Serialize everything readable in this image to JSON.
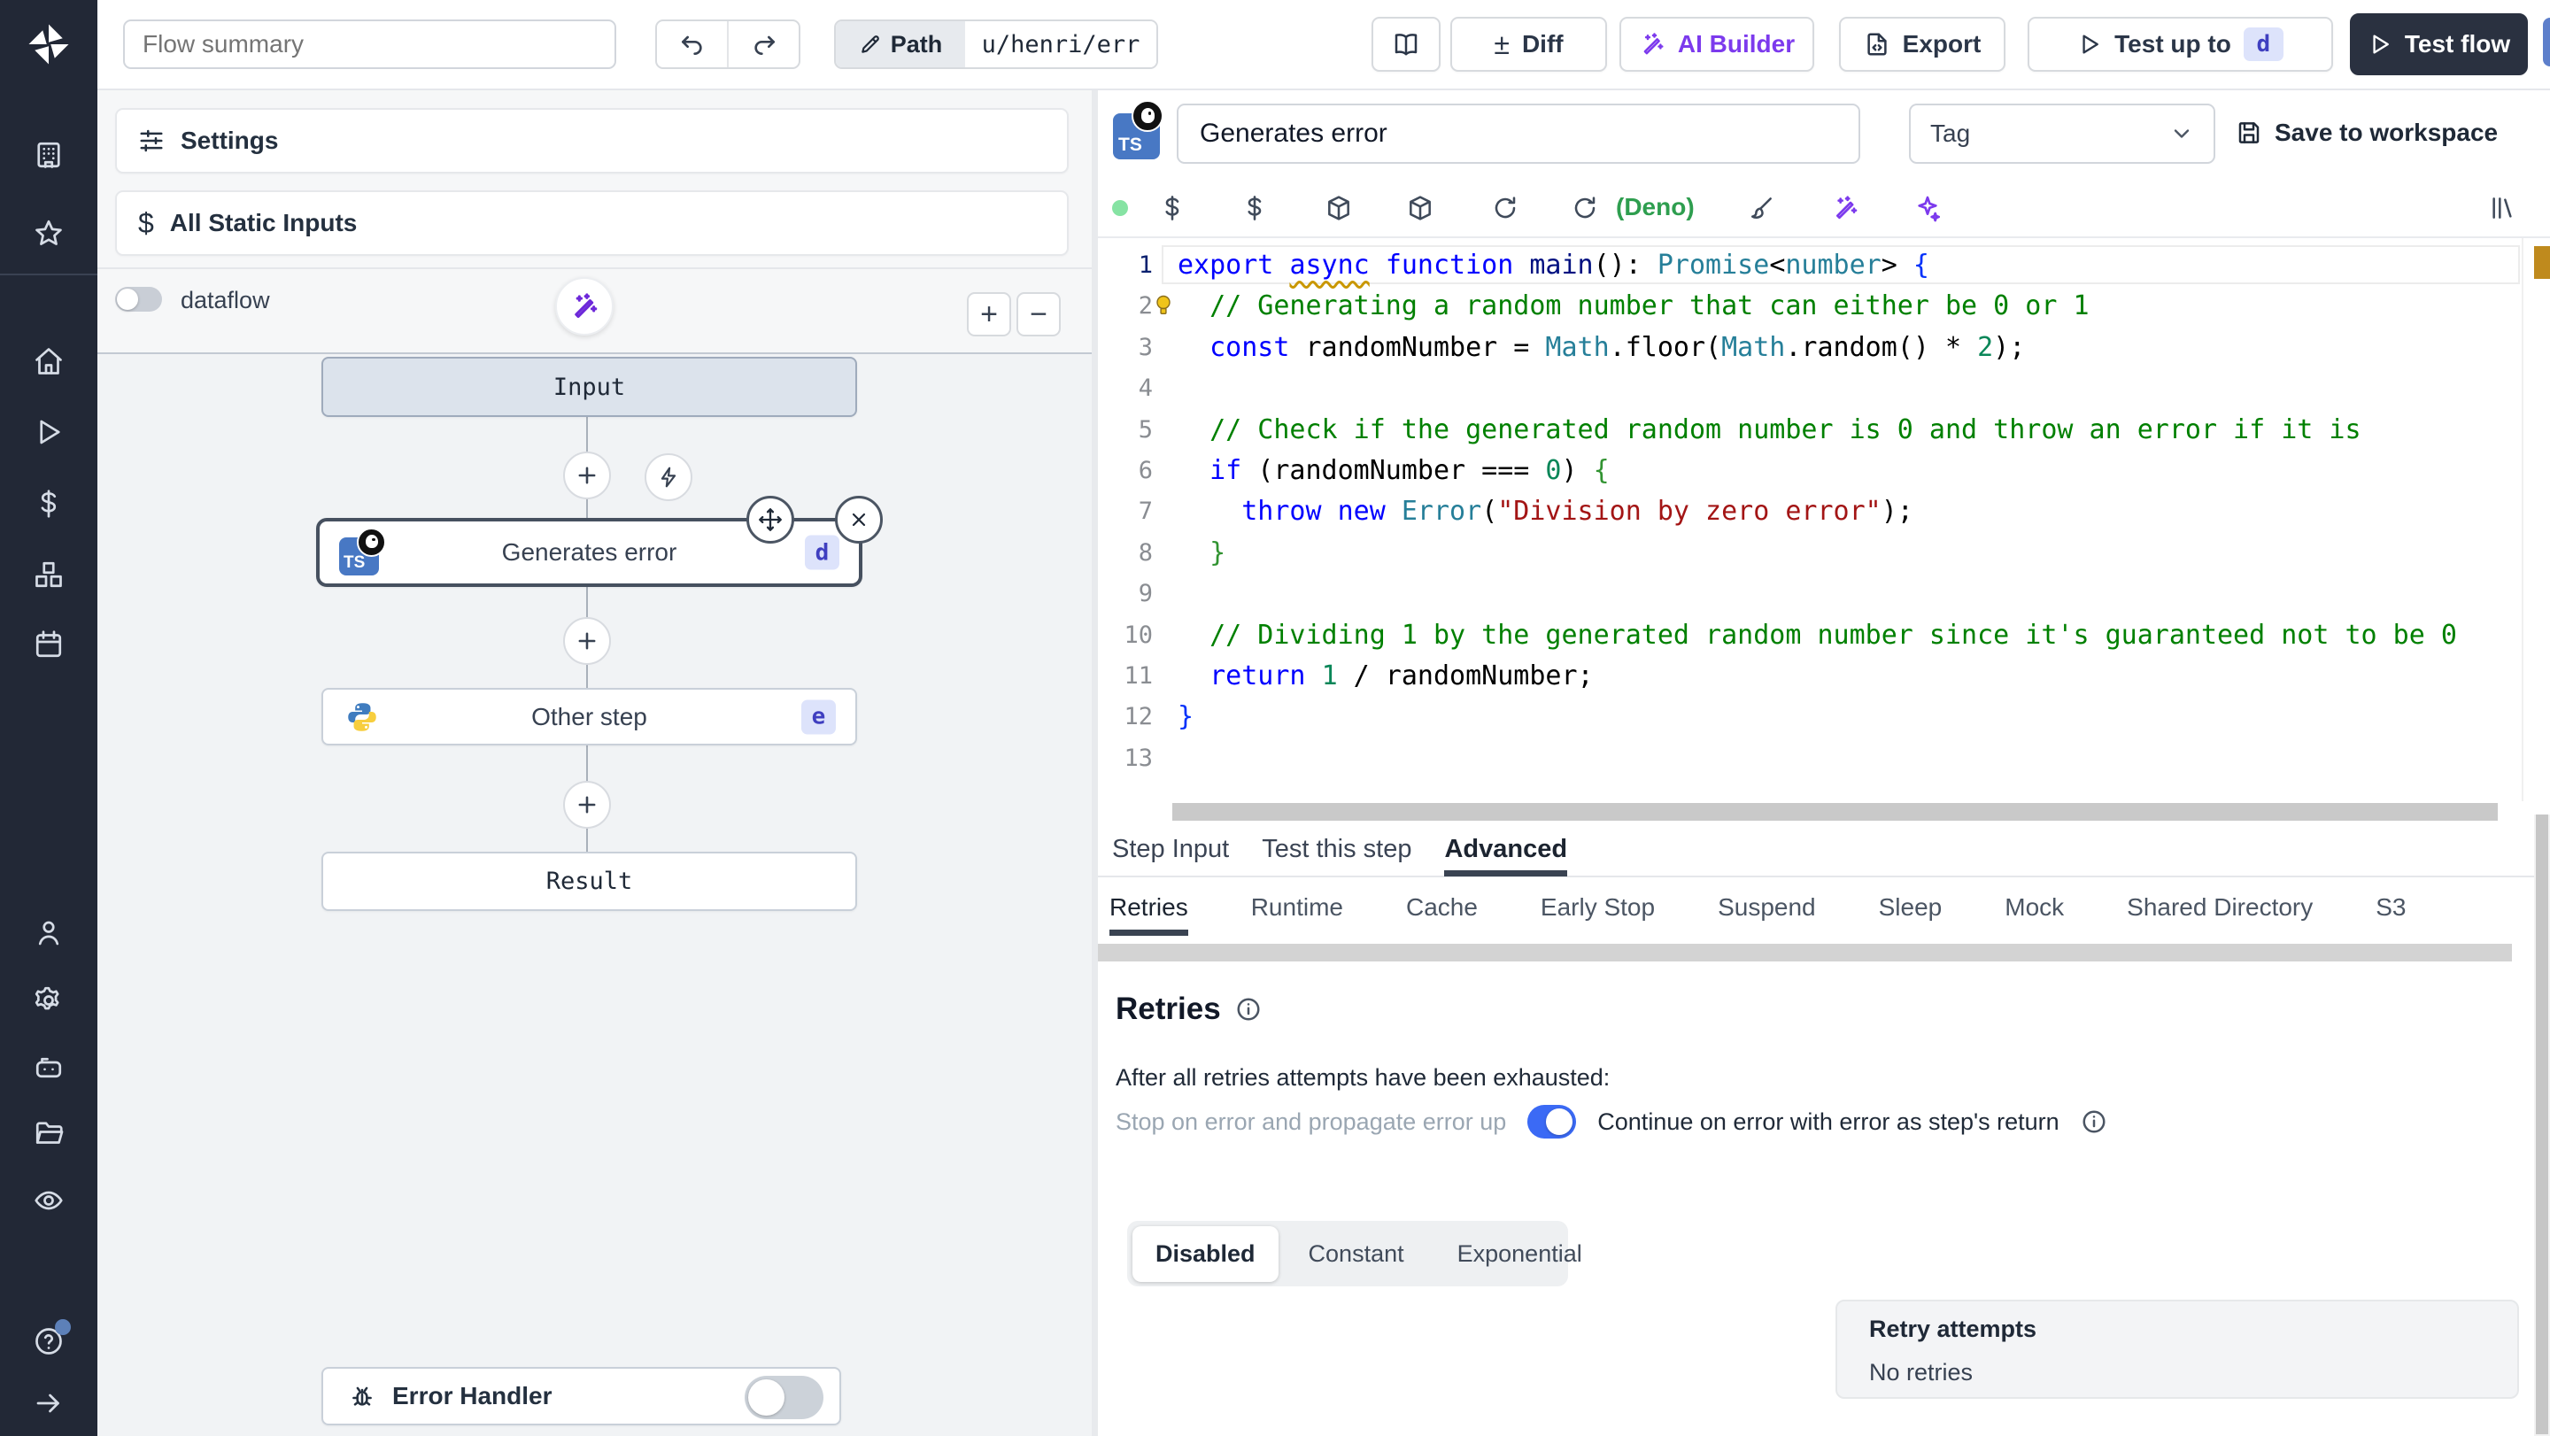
{
  "topbar": {
    "flow_summary_placeholder": "Flow summary",
    "path_label": "Path",
    "path_value": "u/henri/err",
    "diff_symbol": "±",
    "diff_label": "Diff",
    "ai_builder_label": "AI Builder",
    "export_label": "Export",
    "test_up_to_label": "Test up to",
    "test_up_to_badge": "d",
    "test_flow_label": "Test flow"
  },
  "flow_panel": {
    "settings_label": "Settings",
    "static_inputs_symbol": "$",
    "static_inputs_label": "All Static Inputs",
    "dataflow_label": "dataflow",
    "zoom_in_label": "+",
    "zoom_out_label": "−",
    "nodes": {
      "input_label": "Input",
      "step1_label": "Generates error",
      "step1_badge": "d",
      "step2_label": "Other step",
      "step2_badge": "e",
      "result_label": "Result"
    },
    "error_handler_label": "Error Handler"
  },
  "editor": {
    "step_name": "Generates error",
    "tag_placeholder": "Tag",
    "save_label": "Save to workspace",
    "runtime_label": "(Deno)",
    "tabs": [
      "Step Input",
      "Test this step",
      "Advanced"
    ],
    "active_tab": "Advanced",
    "subtabs": [
      "Retries",
      "Runtime",
      "Cache",
      "Early Stop",
      "Suspend",
      "Sleep",
      "Mock",
      "Shared Directory",
      "S3"
    ],
    "active_subtab": "Retries",
    "code": {
      "language": "typescript",
      "bulb_line": 2,
      "current_line": 1,
      "lines": [
        [
          [
            "kw",
            "export "
          ],
          [
            "kww",
            "async"
          ],
          [
            "pl",
            " "
          ],
          [
            "kw",
            "function "
          ],
          [
            "fn",
            "main"
          ],
          [
            "pl",
            "(): "
          ],
          [
            "ty",
            "Promise"
          ],
          [
            "pl",
            "<"
          ],
          [
            "ty",
            "number"
          ],
          [
            "pl",
            "> "
          ],
          [
            "b1",
            "{"
          ]
        ],
        [
          [
            "cm",
            "  // Generating a random number that can either be 0 or 1"
          ]
        ],
        [
          [
            "kw",
            "  const"
          ],
          [
            "pl",
            " randomNumber = "
          ],
          [
            "ty",
            "Math"
          ],
          [
            "pl",
            ".floor("
          ],
          [
            "ty",
            "Math"
          ],
          [
            "pl",
            ".random() * "
          ],
          [
            "nu",
            "2"
          ],
          [
            "pl",
            ");"
          ]
        ],
        [],
        [
          [
            "cm",
            "  // Check if the generated random number is 0 and throw an error if it is"
          ]
        ],
        [
          [
            "kw",
            "  if"
          ],
          [
            "pl",
            " (randomNumber === "
          ],
          [
            "nu",
            "0"
          ],
          [
            "pl",
            ") "
          ],
          [
            "b2",
            "{"
          ]
        ],
        [
          [
            "kw",
            "    throw"
          ],
          [
            "pl",
            " "
          ],
          [
            "kw",
            "new"
          ],
          [
            "pl",
            " "
          ],
          [
            "ty",
            "Error"
          ],
          [
            "pl",
            "("
          ],
          [
            "st",
            "\"Division by zero error\""
          ],
          [
            "pl",
            ");"
          ]
        ],
        [
          [
            "b2",
            "  }"
          ]
        ],
        [],
        [
          [
            "cm",
            "  // Dividing 1 by the generated random number since it's guaranteed not to be 0"
          ]
        ],
        [
          [
            "kw",
            "  return"
          ],
          [
            "pl",
            " "
          ],
          [
            "nu",
            "1"
          ],
          [
            "pl",
            " / randomNumber;"
          ]
        ],
        [
          [
            "b1",
            "}"
          ]
        ],
        []
      ]
    },
    "retries": {
      "heading": "Retries",
      "description": "After all retries attempts have been exhausted:",
      "toggle_left_label": "Stop on error and propagate error up",
      "toggle_right_label": "Continue on error with error as step's return",
      "toggle_state": "on",
      "modes": [
        "Disabled",
        "Constant",
        "Exponential"
      ],
      "active_mode": "Disabled",
      "retry_attempts_title": "Retry attempts",
      "retry_attempts_value": "No retries"
    }
  },
  "colors": {
    "sidebar_bg": "#222836",
    "accent_toggle_blue": "#3b6af5",
    "ai_purple": "#7c3aed",
    "deno_green": "#2e9e4f",
    "badge_bg": "#dde3fb",
    "badge_text": "#3f3fc0",
    "code_keyword": "#0000ff",
    "code_comment": "#008000",
    "code_type": "#267f99",
    "code_string": "#a31515",
    "code_number": "#098658"
  }
}
